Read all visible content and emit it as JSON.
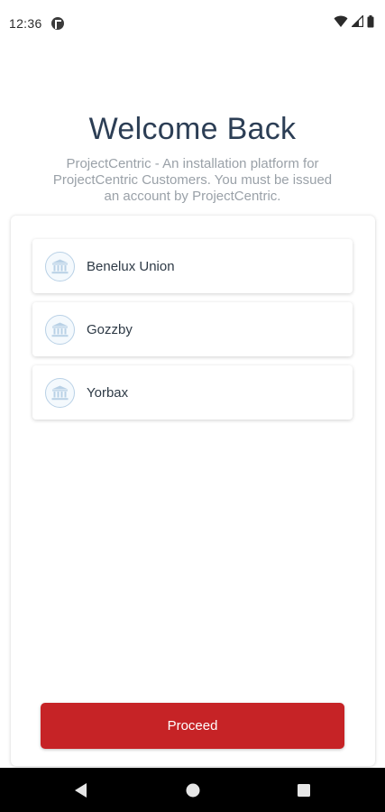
{
  "status_bar": {
    "time": "12:36",
    "icons": [
      "app-notification-icon",
      "wifi-icon",
      "cellular-signal-icon",
      "battery-icon"
    ]
  },
  "header": {
    "title": "Welcome Back",
    "subtitle": "ProjectCentric - An installation platform for ProjectCentric Customers. You must be issued an account by ProjectCentric."
  },
  "organizations": [
    {
      "label": "Benelux Union",
      "icon": "bank-icon"
    },
    {
      "label": "Gozzby",
      "icon": "bank-icon"
    },
    {
      "label": "Yorbax",
      "icon": "bank-icon"
    }
  ],
  "proceed_button": {
    "label": "Proceed"
  },
  "navigation": {
    "icons": [
      "back-icon",
      "home-icon",
      "recents-icon"
    ]
  },
  "colors": {
    "accent": "#c62326",
    "title": "#2c3e55",
    "subtitle": "#9aa1a8",
    "icon_ring": "#b9d1e6"
  }
}
